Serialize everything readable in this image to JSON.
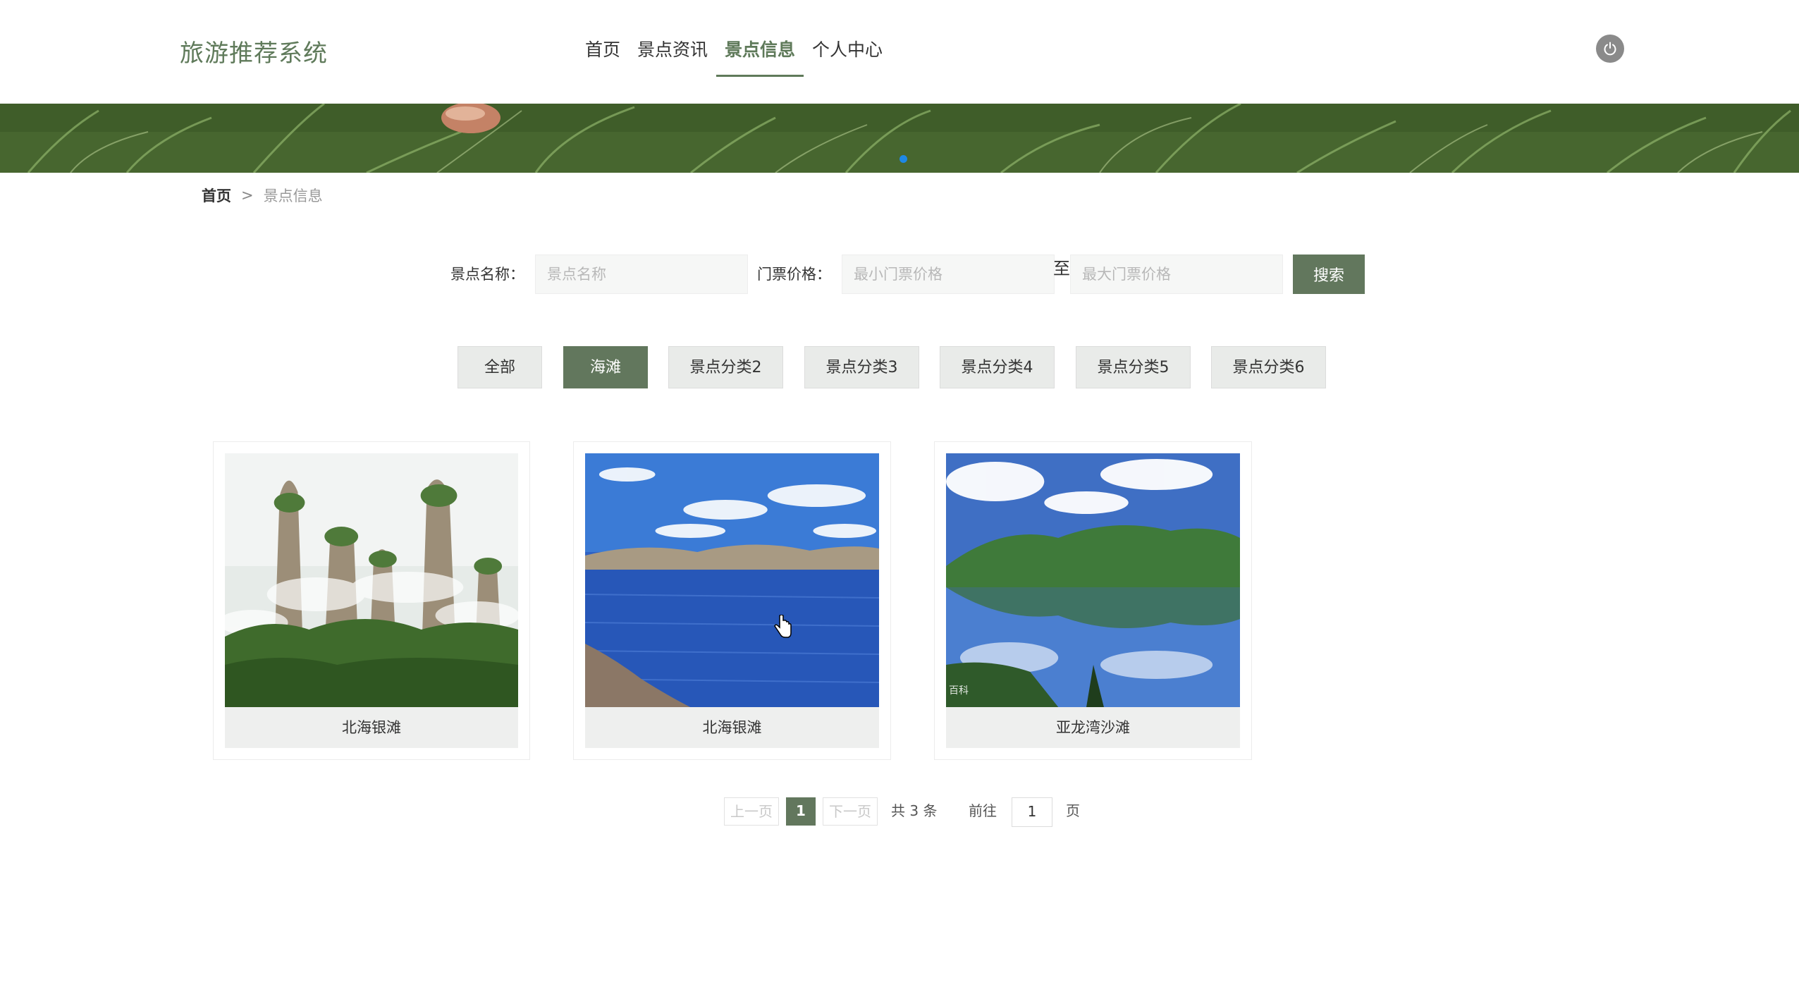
{
  "header": {
    "logo": "旅游推荐系统",
    "nav": [
      "首页",
      "景点资讯",
      "景点信息",
      "个人中心"
    ],
    "active_nav": 2
  },
  "breadcrumb": {
    "home": "首页",
    "separator": ">",
    "current": "景点信息"
  },
  "search": {
    "name_label": "景点名称：",
    "name_placeholder": "景点名称",
    "price_label": "门票价格：",
    "min_placeholder": "最小门票价格",
    "to_label": "至",
    "max_placeholder": "最大门票价格",
    "button": "搜索"
  },
  "categories": [
    "全部",
    "海滩",
    "景点分类2",
    "景点分类3",
    "景点分类4",
    "景点分类5",
    "景点分类6"
  ],
  "active_category": 1,
  "cards": [
    {
      "name": "北海银滩",
      "image": "karst-mountain-photo"
    },
    {
      "name": "北海银滩",
      "image": "blue-lake-photo"
    },
    {
      "name": "亚龙湾沙滩",
      "image": "mountain-lake-reflection-photo"
    }
  ],
  "card_watermark": "百科",
  "pagination": {
    "prev": "上一页",
    "current": "1",
    "next": "下一页",
    "total": "共 3 条",
    "goto_label": "前往",
    "goto_value": "1",
    "page_suffix": "页"
  },
  "colors": {
    "accent": "#62775d",
    "logo": "#5f7a5a",
    "dot": "#1e88e5"
  }
}
